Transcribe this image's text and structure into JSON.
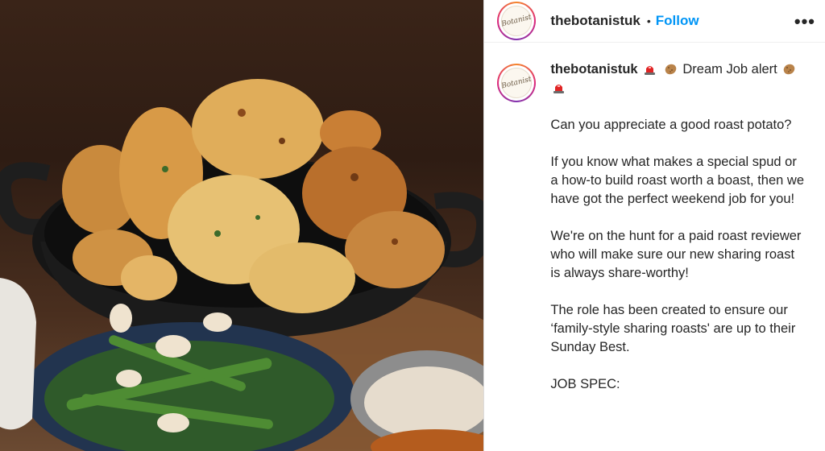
{
  "post": {
    "username": "thebotanistuk",
    "follow_label": "Follow",
    "separator": "•",
    "more_label": "•••",
    "avatar_text": "Botanist"
  },
  "caption": {
    "headline": "Dream Job alert",
    "paragraphs": [
      "Can you appreciate a good roast potato?",
      "If you know what makes a special spud or a how-to build roast worth a boast, then we have got the perfect weekend job for you!",
      "We're on the hunt for a paid roast reviewer who will make sure our new sharing roast is always share-worthy!",
      "The role has been created to ensure our ‘family-style sharing roasts' are up to their Sunday Best.",
      "JOB SPEC:"
    ]
  },
  "icons": {
    "siren": "siren-icon",
    "potato": "potato-icon"
  },
  "colors": {
    "follow": "#0095f6",
    "text": "#262626",
    "border": "#dbdbdb"
  }
}
